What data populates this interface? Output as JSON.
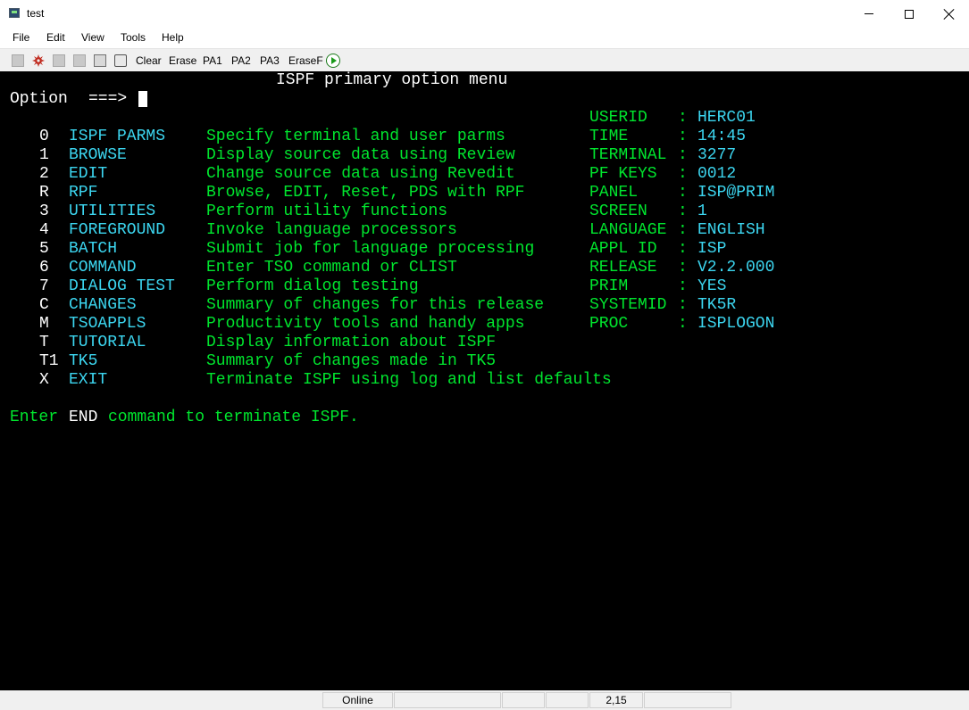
{
  "window": {
    "title": "test"
  },
  "menu": [
    "File",
    "Edit",
    "View",
    "Tools",
    "Help"
  ],
  "toolbar": {
    "icons": [
      "disabled-icon",
      "gear-icon",
      "copy-icon",
      "paste-icon",
      "print-icon",
      "clipboard-icon"
    ],
    "buttons": [
      "Clear",
      "Erase",
      "PA1",
      "PA2",
      "PA3",
      "EraseF"
    ],
    "run_icon": "play-icon"
  },
  "colors": {
    "background": "#000000",
    "white": "#ffffff",
    "green": "#00e62e",
    "cyan": "#3cd6f0"
  },
  "terminal": {
    "panel_title": "ISPF primary option menu",
    "option_label": "Option",
    "option_arrow": "===>",
    "options": [
      {
        "key": "0",
        "name": "ISPF PARMS",
        "desc": "Specify terminal and user parms"
      },
      {
        "key": "1",
        "name": "BROWSE",
        "desc": "Display source data using Review"
      },
      {
        "key": "2",
        "name": "EDIT",
        "desc": "Change source data using Revedit"
      },
      {
        "key": "R",
        "name": "RPF",
        "desc": "Browse, EDIT, Reset, PDS with RPF"
      },
      {
        "key": "3",
        "name": "UTILITIES",
        "desc": "Perform utility functions"
      },
      {
        "key": "4",
        "name": "FOREGROUND",
        "desc": "Invoke language processors"
      },
      {
        "key": "5",
        "name": "BATCH",
        "desc": "Submit job for language processing"
      },
      {
        "key": "6",
        "name": "COMMAND",
        "desc": "Enter TSO command or CLIST"
      },
      {
        "key": "7",
        "name": "DIALOG TEST",
        "desc": "Perform dialog testing"
      },
      {
        "key": "C",
        "name": "CHANGES",
        "desc": "Summary of changes for this release"
      },
      {
        "key": "M",
        "name": "TSOAPPLS",
        "desc": "Productivity tools and handy apps"
      },
      {
        "key": "T",
        "name": "TUTORIAL",
        "desc": "Display information about ISPF"
      },
      {
        "key": "T1",
        "name": "TK5",
        "desc": "Summary of changes made in TK5"
      },
      {
        "key": "X",
        "name": "EXIT",
        "desc": "Terminate ISPF using log and list defaults"
      }
    ],
    "info": [
      {
        "label": "USERID",
        "value": "HERC01"
      },
      {
        "label": "TIME",
        "value": "14:45"
      },
      {
        "label": "TERMINAL",
        "value": "3277"
      },
      {
        "label": "PF KEYS",
        "value": "0012"
      },
      {
        "label": "PANEL",
        "value": "ISP@PRIM"
      },
      {
        "label": "SCREEN",
        "value": "1"
      },
      {
        "label": "LANGUAGE",
        "value": "ENGLISH"
      },
      {
        "label": "APPL ID",
        "value": "ISP"
      },
      {
        "label": "RELEASE",
        "value": "V2.2.000"
      },
      {
        "label": "PRIM",
        "value": "YES"
      },
      {
        "label": "SYSTEMID",
        "value": "TK5R"
      },
      {
        "label": "PROC",
        "value": "ISPLOGON"
      }
    ],
    "info_separator": ":",
    "footer": {
      "part1": "Enter",
      "part2": "END",
      "part3": "command to terminate ISPF."
    }
  },
  "status": {
    "connection": "Online",
    "cursor_position": "2,15"
  }
}
